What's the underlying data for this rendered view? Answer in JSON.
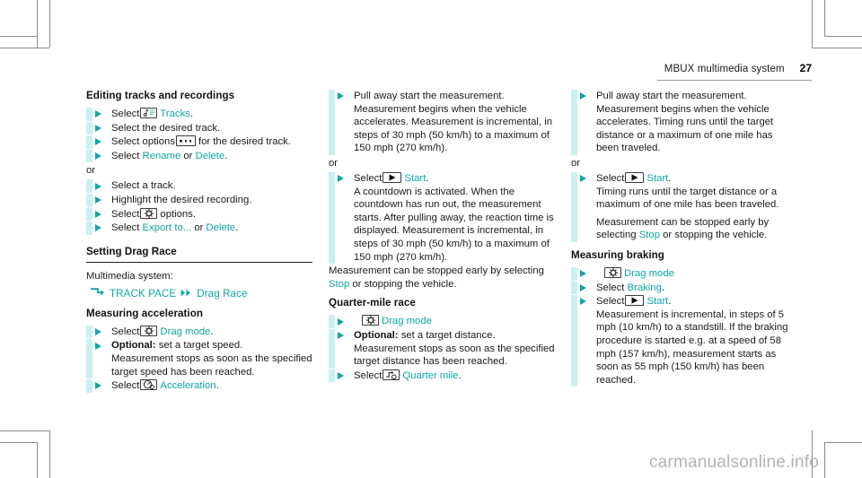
{
  "header": {
    "title": "MBUX multimedia system",
    "page_number": "27"
  },
  "watermark": "carmanualsonline.info",
  "column1": {
    "heading": "Editing tracks and recordings",
    "steps": [
      {
        "pre": "Select",
        "icon": "tracks-icon",
        "link": "Tracks",
        "post": "."
      },
      {
        "pre": "Select the desired track.",
        "icon": "",
        "link": "",
        "post": ""
      },
      {
        "pre": "Select options",
        "icon": "options-dots-icon",
        "link": "",
        "post": "for the desired track."
      },
      {
        "pre": "Select",
        "icon": "",
        "link": "Rename",
        "mid": "or",
        "link2": "Delete",
        "post": "."
      }
    ],
    "or_label": "or",
    "steps2": [
      {
        "pre": "Select a track.",
        "icon": "",
        "link": "",
        "post": ""
      },
      {
        "pre": "Highlight the desired recording.",
        "icon": "",
        "link": "",
        "post": ""
      },
      {
        "pre": "Select",
        "icon": "gear-icon",
        "link": "",
        "post": "options."
      },
      {
        "pre": "Select",
        "icon": "",
        "link": "Export to...",
        "mid": "or",
        "link2": "Delete",
        "post": "."
      }
    ],
    "section2_heading": "Setting Drag Race",
    "multimedia_label": "Multimedia system:",
    "path": {
      "root": "TRACK PACE",
      "child": "Drag Race"
    },
    "section3_heading": "Measuring acceleration",
    "steps3": [
      {
        "pre": "Select",
        "icon": "gear-icon",
        "link": "Drag mode",
        "post": "."
      },
      {
        "bold": "Optional:",
        "pre": " set a target speed.",
        "body": "Measurement stops as soon as the specified target speed has been reached."
      },
      {
        "pre": "Select",
        "icon": "acceleration-icon",
        "link": "Acceleration",
        "post": "."
      }
    ]
  },
  "column2": {
    "step1": {
      "title": "Pull away start the measurement.",
      "body": "Measurement begins when the vehicle accelerates. Measurement is incremental, in steps of 30 mph (50 km/h) to a maximum of  150 mph (270 km/h)."
    },
    "or_label": "or",
    "step2": {
      "pre": "Select",
      "icon": "play-start-icon",
      "link": "Start",
      "post": ".",
      "body": "A countdown is activated. When the countdown has run out, the measurement starts. After pulling away, the reaction time is displayed. Measurement is incremental, in steps of 30 mph (50 km/h) to a maximum of  150 mph (270 km/h)."
    },
    "note_pre": "Measurement can be stopped early by selecting",
    "note_link": "Stop",
    "note_post": "or stopping the vehicle.",
    "section_heading": "Quarter-mile race",
    "steps": [
      {
        "icon": "gear-icon",
        "link": "Drag mode",
        "post": ""
      },
      {
        "bold": "Optional:",
        "pre": " set a target distance.",
        "body": "Measurement stops as soon as the specified target distance has been reached."
      },
      {
        "pre": "Select",
        "icon": "quarter-mile-icon",
        "link": "Quarter mile",
        "post": "."
      }
    ]
  },
  "column3": {
    "step1": {
      "title": "Pull away start the measurement.",
      "body": "Measurement begins when the vehicle accelerates. Timing runs until the target distance or a maximum of one mile has been traveled."
    },
    "or_label": "or",
    "step2": {
      "pre": "Select",
      "icon": "play-start-icon",
      "link": "Start",
      "post": ".",
      "body": "Timing runs until the target distance or a maximum of one mile has been traveled.",
      "body2_pre": "Measurement can be stopped early by selecting",
      "body2_link": "Stop",
      "body2_post": "or stopping the vehicle."
    },
    "section_heading": "Measuring braking",
    "steps": [
      {
        "icon": "gear-icon",
        "link": "Drag mode",
        "post": ""
      },
      {
        "pre": "Select",
        "link": "Braking",
        "post": "."
      },
      {
        "pre": "Select",
        "icon": "play-start-icon",
        "link": "Start",
        "post": ".",
        "body": "Measurement is incremental, in steps of 5 mph (10 km/h) to a standstill. If the braking procedure is started e.g. at a speed of 58 mph (157 km/h), measurement starts as soon as 55 mph (150 km/h) has been reached."
      }
    ]
  },
  "colors": {
    "accent_teal": "#0fa5a5",
    "bar_cyan": "#c9f0f0",
    "text": "#1a1a1a",
    "watermark_gray": "#b3b3b3"
  }
}
